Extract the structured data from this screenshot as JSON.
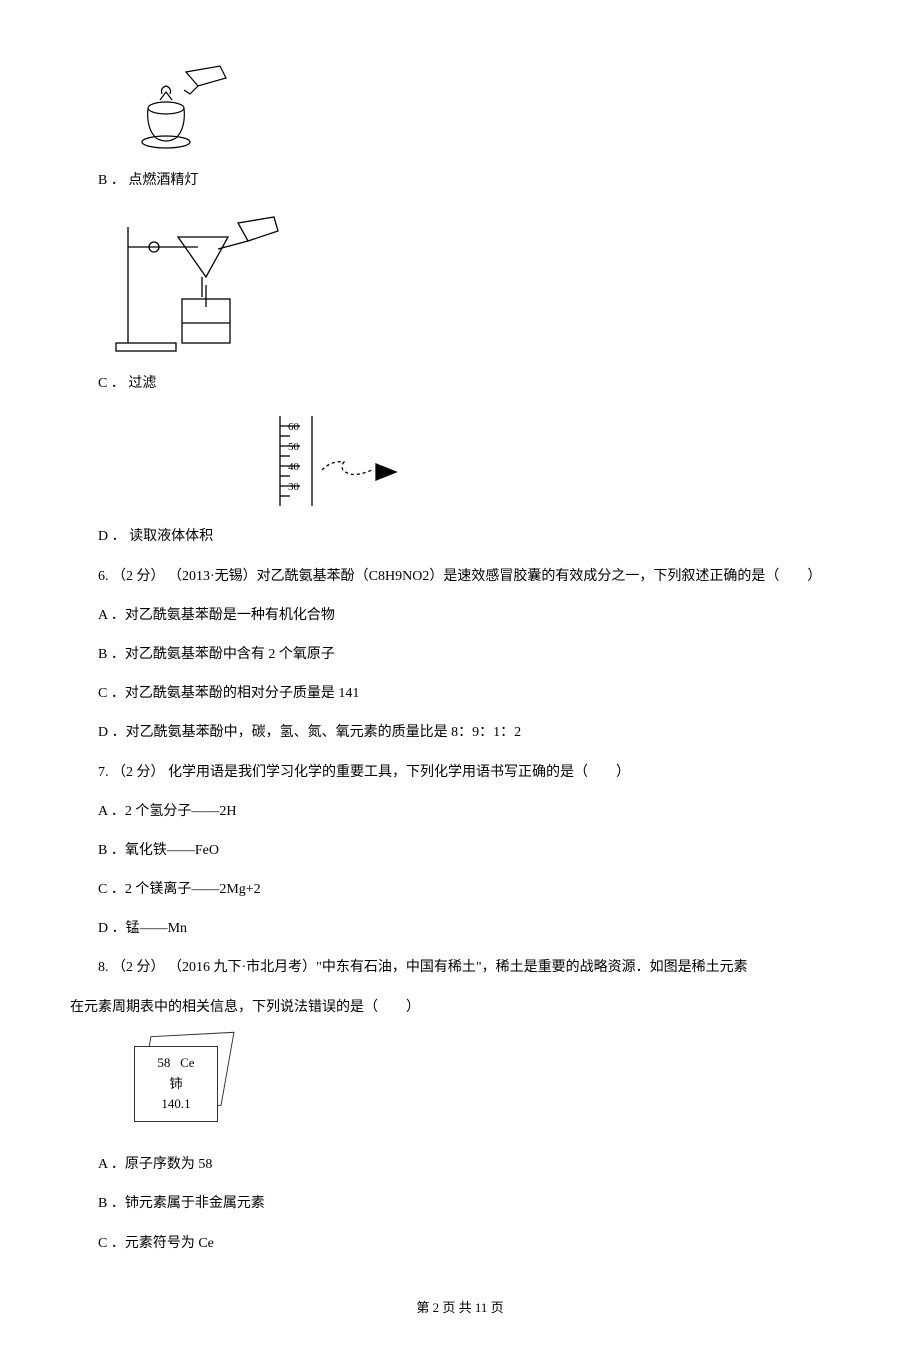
{
  "opt5b": {
    "letter": "B ．",
    "text": "点燃酒精灯"
  },
  "opt5c": {
    "letter": "C ．",
    "text": "过滤"
  },
  "opt5d": {
    "letter": "D ．",
    "text": "读取液体体积"
  },
  "q6": {
    "stem": "6. （2 分） （2013·无锡）对乙酰氨基苯酚（C8H9NO2）是速效感冒胶囊的有效成分之一，下列叙述正确的是（　　）",
    "a": "A ．对乙酰氨基苯酚是一种有机化合物",
    "b": "B ．对乙酰氨基苯酚中含有 2 个氧原子",
    "c": "C ．对乙酰氨基苯酚的相对分子质量是 141",
    "d": "D ．对乙酰氨基苯酚中，碳，氢、氮、氧元素的质量比是 8：9：1：2"
  },
  "q7": {
    "stem": "7. （2 分） 化学用语是我们学习化学的重要工具，下列化学用语书写正确的是（　　）",
    "a": "A ．2 个氢分子——2H",
    "b": "B ．氧化铁——FeO",
    "c": "C ．2 个镁离子——2Mg+2",
    "d": "D ．锰——Mn"
  },
  "q8": {
    "stem_line1": "8. （2 分） （2016 九下·市北月考）\"中东有石油，中国有稀土\"，稀土是重要的战略资源．如图是稀土元素",
    "stem_line2": "在元素周期表中的相关信息，下列说法错误的是（　　）",
    "element": {
      "num": "58",
      "symbol": "Ce",
      "name": "铈",
      "mass": "140.1"
    },
    "a": "A ．原子序数为 58",
    "b": "B ．铈元素属于非金属元素",
    "c": "C ．元素符号为 Ce"
  },
  "cylinder_ticks": [
    "60",
    "50",
    "40",
    "30"
  ],
  "footer": "第 2 页 共 11 页"
}
